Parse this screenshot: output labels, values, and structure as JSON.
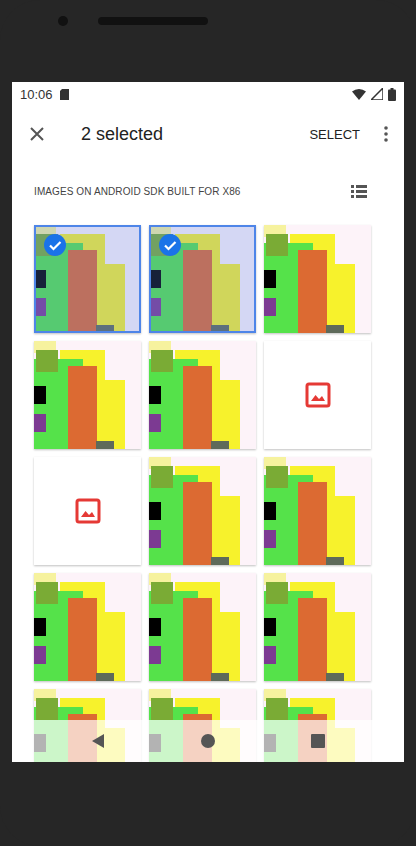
{
  "status_bar": {
    "time": "10:06"
  },
  "app_bar": {
    "title": "2 selected",
    "action": "SELECT"
  },
  "subheader": {
    "title": "IMAGES ON ANDROID SDK BUILT FOR X86"
  },
  "grid": {
    "items": [
      {
        "kind": "image",
        "selected": true
      },
      {
        "kind": "image",
        "selected": true
      },
      {
        "kind": "image",
        "selected": false
      },
      {
        "kind": "image",
        "selected": false
      },
      {
        "kind": "image",
        "selected": false
      },
      {
        "kind": "broken",
        "selected": false
      },
      {
        "kind": "broken",
        "selected": false
      },
      {
        "kind": "image",
        "selected": false
      },
      {
        "kind": "image",
        "selected": false
      },
      {
        "kind": "image",
        "selected": false
      },
      {
        "kind": "image",
        "selected": false
      },
      {
        "kind": "image",
        "selected": false
      },
      {
        "kind": "image",
        "selected": false
      },
      {
        "kind": "image",
        "selected": false
      },
      {
        "kind": "image",
        "selected": false
      }
    ]
  }
}
